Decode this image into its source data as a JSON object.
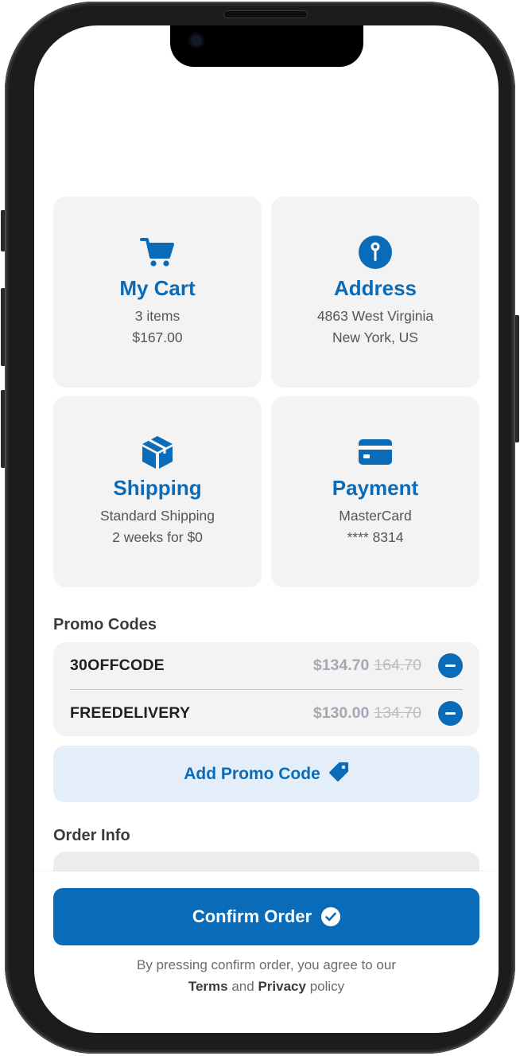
{
  "cards": [
    {
      "icon": "cart-icon",
      "title": "My Cart",
      "lines": [
        "3 items",
        "$167.00"
      ]
    },
    {
      "icon": "map-pin-icon",
      "title": "Address",
      "lines": [
        "4863 West Virginia",
        "New York, US"
      ]
    },
    {
      "icon": "package-icon",
      "title": "Shipping",
      "lines": [
        "Standard Shipping",
        "2 weeks for $0"
      ]
    },
    {
      "icon": "credit-card-icon",
      "title": "Payment",
      "lines": [
        "MasterCard",
        "**** 8314"
      ]
    }
  ],
  "promo": {
    "title": "Promo Codes",
    "codes": [
      {
        "code": "30OFFCODE",
        "new_price": "$134.70",
        "old_price": "164.70"
      },
      {
        "code": "FREEDELIVERY",
        "new_price": "$130.00",
        "old_price": "134.70"
      }
    ],
    "add_label": "Add Promo Code",
    "add_icon": "tag-icon"
  },
  "order_info": {
    "title": "Order Info"
  },
  "footer": {
    "confirm_label": "Confirm Order",
    "confirm_icon": "check-circle-icon",
    "legal_line1": "By pressing confirm order, you agree to our",
    "terms": "Terms",
    "and": "and",
    "privacy": "Privacy",
    "policy": "policy"
  },
  "colors": {
    "accent": "#0a6bb8",
    "card_bg": "#f3f3f3",
    "promo_button_bg": "#e3eef8"
  }
}
